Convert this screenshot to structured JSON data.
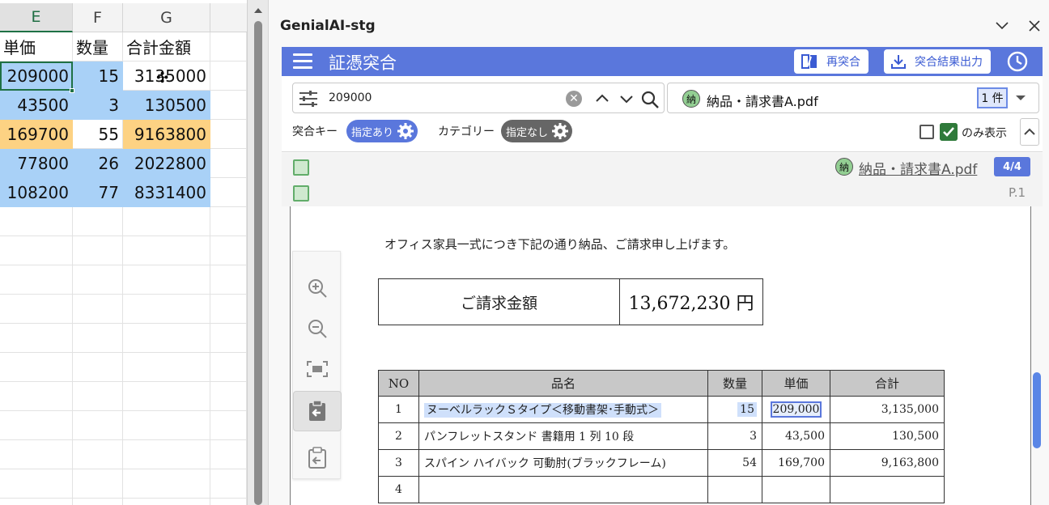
{
  "sheet": {
    "columns": [
      {
        "label": "E",
        "selected": true
      },
      {
        "label": "F",
        "selected": false
      },
      {
        "label": "G",
        "selected": false
      }
    ],
    "header_row": [
      "単価",
      "数量",
      "合計金額"
    ],
    "rows": [
      {
        "unit": "209000",
        "qty": "15",
        "total": "3135000",
        "unit_bg": "blue",
        "qty_bg": "blue",
        "total_bg": "white"
      },
      {
        "unit": "43500",
        "qty": "3",
        "total": "130500",
        "unit_bg": "blue",
        "qty_bg": "blue",
        "total_bg": "blue"
      },
      {
        "unit": "169700",
        "qty": "55",
        "total": "9163800",
        "unit_bg": "orange",
        "qty_bg": "white",
        "total_bg": "orange"
      },
      {
        "unit": "77800",
        "qty": "26",
        "total": "2022800",
        "unit_bg": "blue",
        "qty_bg": "blue",
        "total_bg": "blue"
      },
      {
        "unit": "108200",
        "qty": "77",
        "total": "8331400",
        "unit_bg": "blue",
        "qty_bg": "blue",
        "total_bg": "blue"
      }
    ]
  },
  "panel": {
    "title": "GenialAI-stg",
    "app_title": "証憑突合",
    "rematch_label": "再突合",
    "export_label": "突合結果出力",
    "search": {
      "value": "209000",
      "placeholder": ""
    },
    "file_badge": "納",
    "file_name": "納品・請求書A.pdf",
    "count": "1 件",
    "match_key_label": "突合キー",
    "match_key_pill": "指定あり",
    "category_label": "カテゴリー",
    "category_pill": "指定なし",
    "only_label": "のみ表示",
    "result_file": "納品・請求書A.pdf",
    "result_count": "4/4",
    "page_label": "P.1"
  },
  "document": {
    "intro": "オフィス家具一式につき下記の通り納品、ご請求申し上げます。",
    "amount_label": "ご請求金額",
    "amount_value": "13,672,230 円",
    "table": {
      "headers": [
        "NO",
        "品名",
        "数量",
        "単価",
        "合計"
      ],
      "rows": [
        {
          "no": "1",
          "name": "ヌーベルラックＳタイプ＜移動書架･手動式＞",
          "qty": "15",
          "price": "209,000",
          "total": "3,135,000"
        },
        {
          "no": "2",
          "name": "パンフレットスタンド 書籍用 1 列 10 段",
          "qty": "3",
          "price": "43,500",
          "total": "130,500"
        },
        {
          "no": "3",
          "name": "スパイン ハイバック 可動肘(ブラックフレーム)",
          "qty": "54",
          "price": "169,700",
          "total": "9,163,800"
        },
        {
          "no": "4",
          "name": "",
          "qty": "",
          "price": "",
          "total": ""
        }
      ]
    }
  },
  "colors": {
    "accent": "#5a77dc",
    "sheet_blue": "#a9d1f7",
    "sheet_orange": "#fdd283",
    "check_green": "#2f7a3a"
  }
}
